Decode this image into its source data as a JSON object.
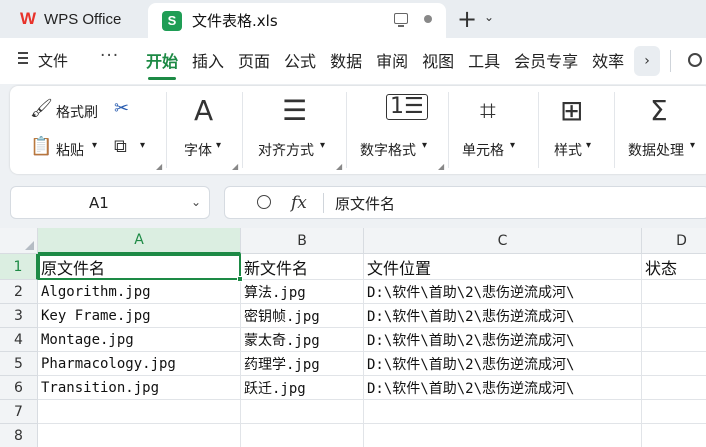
{
  "titlebar": {
    "app_name": "WPS Office",
    "app_logo": "W",
    "file_icon_letter": "S",
    "file_name": "文件表格.xls"
  },
  "menubar": {
    "file": "文件",
    "more": "···",
    "tabs": [
      "开始",
      "插入",
      "页面",
      "公式",
      "数据",
      "审阅",
      "视图",
      "工具",
      "会员专享",
      "效率"
    ],
    "active_tab": "开始"
  },
  "ribbon": {
    "format_painter": "格式刷",
    "paste": "粘贴",
    "font": "字体",
    "align": "对齐方式",
    "number_format": "数字格式",
    "cell": "单元格",
    "style": "样式",
    "data_process": "数据处理",
    "font_glyph": "A",
    "sum_glyph": "Σ"
  },
  "formula_bar": {
    "cell_ref": "A1",
    "fx_label": "fx",
    "content": "原文件名"
  },
  "sheet": {
    "columns": [
      "A",
      "B",
      "C",
      "D"
    ],
    "rows": [
      "1",
      "2",
      "3",
      "4",
      "5",
      "6",
      "7",
      "8"
    ],
    "cells": [
      [
        "原文件名",
        "新文件名",
        "文件位置",
        "状态"
      ],
      [
        "Algorithm.jpg",
        "算法.jpg",
        "D:\\软件\\首助\\2\\悲伤逆流成河\\",
        ""
      ],
      [
        "Key Frame.jpg",
        "密钥帧.jpg",
        "D:\\软件\\首助\\2\\悲伤逆流成河\\",
        ""
      ],
      [
        "Montage.jpg",
        "蒙太奇.jpg",
        "D:\\软件\\首助\\2\\悲伤逆流成河\\",
        ""
      ],
      [
        "Pharmacology.jpg",
        "药理学.jpg",
        "D:\\软件\\首助\\2\\悲伤逆流成河\\",
        ""
      ],
      [
        "Transition.jpg",
        "跃迁.jpg",
        "D:\\软件\\首助\\2\\悲伤逆流成河\\",
        ""
      ],
      [
        "",
        "",
        "",
        ""
      ],
      [
        "",
        "",
        "",
        ""
      ]
    ]
  },
  "colors": {
    "accent": "#1d8a45",
    "wps_red": "#e8322a"
  }
}
